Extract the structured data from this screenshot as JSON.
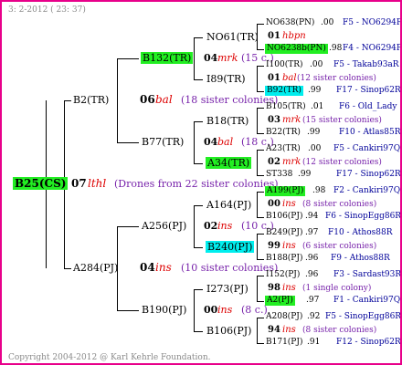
{
  "header": {
    "text": "3:  2-2012 ( 23: 37)"
  },
  "footer": {
    "text": "Copyright 2004-2012 @ Karl Kehrle Foundation."
  },
  "colors": {
    "frame": "#e8008a",
    "green_highlight": "#22ee22",
    "cyan_highlight": "#00eeee",
    "year_letter": "#dd0000",
    "link": "#000099",
    "sisters": "#7722aa"
  },
  "root": {
    "label": "B25(CS)"
  },
  "gen1": {
    "year": "07",
    "marker": "lthl",
    "note": "(Drones from 22 sister colonies)",
    "dam": "B2(TR)",
    "sire": "A284(PJ)"
  },
  "b2": {
    "year": "06",
    "marker": "bal",
    "note": "(18 sister colonies)",
    "dam": "B132(TR)",
    "sire": "B77(TR)",
    "b132": {
      "year": "04",
      "marker": "mrk",
      "note": "(15 c.)",
      "dam": "NO61(TR)",
      "sire": "I89(TR)",
      "no61": {
        "dam": {
          "name": "NO638(PN)",
          "val": ".00",
          "ref": "F5 - NO6294R"
        },
        "mid": {
          "year": "01",
          "marker": "hbpn"
        },
        "sire": {
          "name": "NO6238b(PN)",
          "val": ".98",
          "ref": "F4 - NO6294R"
        }
      },
      "i89": {
        "dam": {
          "name": "I100(TR)",
          "val": ".00",
          "ref": "F5 - Takab93aR"
        },
        "mid": {
          "year": "01",
          "marker": "bal",
          "note": "(12 sister colonies)"
        },
        "sire": {
          "name": "B92(TR)",
          "val": ".99",
          "ref": "F17 - Sinop62R"
        }
      }
    },
    "b77": {
      "year": "04",
      "marker": "bal",
      "note": "(18 c.)",
      "dam": "B18(TR)",
      "sire": "A34(TR)",
      "b18": {
        "dam": {
          "name": "B105(TR)",
          "val": ".01",
          "ref": "F6 - Old_Lady"
        },
        "mid": {
          "year": "03",
          "marker": "mrk",
          "note": "(15 sister colonies)"
        },
        "sire": {
          "name": "B22(TR)",
          "val": ".99",
          "ref": "F10 - Atlas85R"
        }
      },
      "a34": {
        "dam": {
          "name": "A23(TR)",
          "val": ".00",
          "ref": "F5 - Cankiri97Q"
        },
        "mid": {
          "year": "02",
          "marker": "mrk",
          "note": "(12 sister colonies)"
        },
        "sire": {
          "name": "ST338",
          "val": ".99",
          "ref": "F17 - Sinop62R"
        }
      }
    }
  },
  "a284": {
    "year": "04",
    "marker": "ins",
    "note": "(10 sister colonies)",
    "dam": "A256(PJ)",
    "sire": "B190(PJ)",
    "a256": {
      "year": "02",
      "marker": "ins",
      "note": "(10 c.)",
      "dam": "A164(PJ)",
      "sire": "B240(PJ)",
      "a164": {
        "dam": {
          "name": "A199(PJ)",
          "val": ".98",
          "ref": "F2 - Cankiri97Q"
        },
        "mid": {
          "year": "00",
          "marker": "ins",
          "note": "(8 sister colonies)"
        },
        "sire": {
          "name": "B106(PJ)",
          "val": ".94",
          "ref": "F6 - SinopEgg86R"
        }
      },
      "b240": {
        "dam": {
          "name": "B249(PJ)",
          "val": ".97",
          "ref": "F10 - Athos88R"
        },
        "mid": {
          "year": "99",
          "marker": "ins",
          "note": "(6 sister colonies)"
        },
        "sire": {
          "name": "B188(PJ)",
          "val": ".96",
          "ref": "F9 - Athos88R"
        }
      }
    },
    "b190": {
      "year": "00",
      "marker": "ins",
      "note": "(8 c.)",
      "dam": "I273(PJ)",
      "sire": "B106(PJ)",
      "i273": {
        "dam": {
          "name": "I152(PJ)",
          "val": ".96",
          "ref": "F3 - Sardast93R"
        },
        "mid": {
          "year": "98",
          "marker": "ins",
          "note": "(1 single colony)"
        },
        "sire": {
          "name": "A2(PJ)",
          "val": ".97",
          "ref": "F1 - Cankiri97Q"
        }
      },
      "b106": {
        "dam": {
          "name": "A208(PJ)",
          "val": ".92",
          "ref": "F5 - SinopEgg86R"
        },
        "mid": {
          "year": "94",
          "marker": "ins",
          "note": "(8 sister colonies)"
        },
        "sire": {
          "name": "B171(PJ)",
          "val": ".91",
          "ref": "F12 - Sinop62R"
        }
      }
    }
  }
}
